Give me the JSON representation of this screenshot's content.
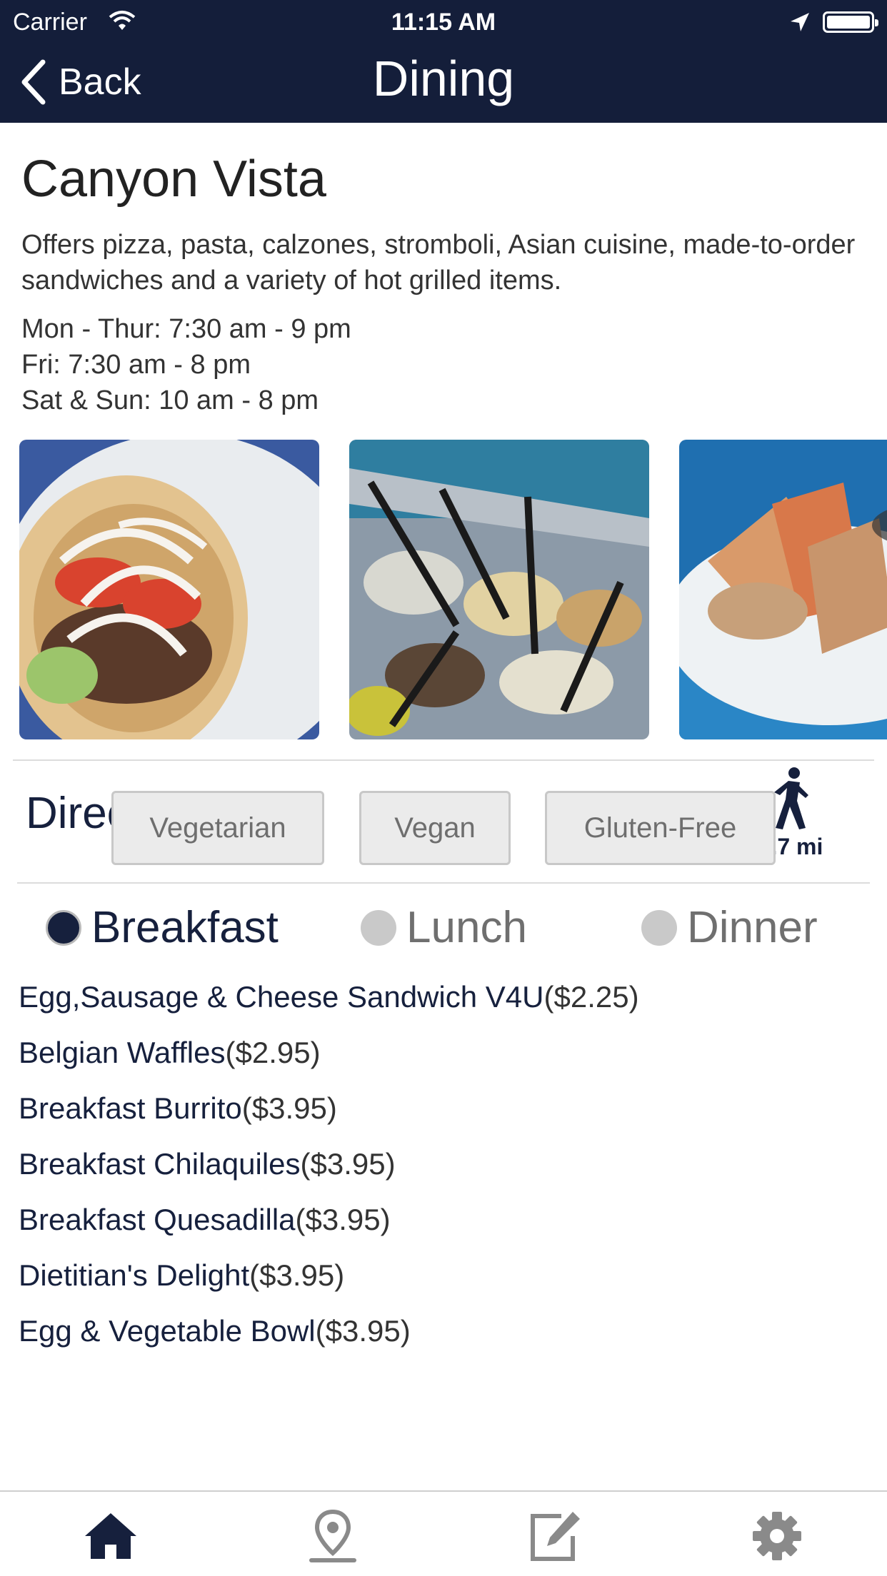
{
  "status_bar": {
    "carrier": "Carrier",
    "time": "11:15 AM"
  },
  "nav": {
    "back_label": "Back",
    "title": "Dining"
  },
  "location": {
    "name": "Canyon Vista",
    "description": "Offers pizza, pasta, calzones, stromboli, Asian cuisine, made-to-order sandwiches and a variety of hot grilled items.",
    "hours": [
      "Mon - Thur: 7:30 am - 9 pm",
      "Fri: 7:30 am - 8 pm",
      "Sat & Sun: 10 am - 8 pm"
    ]
  },
  "directions": {
    "label": "Directions",
    "distance": "0.7 mi"
  },
  "filters": [
    "Vegetarian",
    "Vegan",
    "Gluten-Free"
  ],
  "meals": [
    {
      "label": "Breakfast",
      "selected": true
    },
    {
      "label": "Lunch",
      "selected": false
    },
    {
      "label": "Dinner",
      "selected": false
    }
  ],
  "menu": [
    {
      "name": "Egg,Sausage & Cheese Sandwich V4U",
      "price": "($2.25)"
    },
    {
      "name": "Belgian Waffles",
      "price": "($2.95)"
    },
    {
      "name": "Breakfast Burrito",
      "price": "($3.95)"
    },
    {
      "name": "Breakfast Chilaquiles",
      "price": "($3.95)"
    },
    {
      "name": "Breakfast Quesadilla",
      "price": "($3.95)"
    },
    {
      "name": "Dietitian's Delight",
      "price": "($3.95)"
    },
    {
      "name": "Egg & Vegetable Bowl",
      "price": "($3.95)"
    }
  ],
  "tabs": [
    "home-icon",
    "map-pin-icon",
    "edit-icon",
    "gear-icon"
  ],
  "colors": {
    "nav_bg": "#141e3a",
    "accent": "#16203d",
    "inactive": "#c9c9c9"
  }
}
